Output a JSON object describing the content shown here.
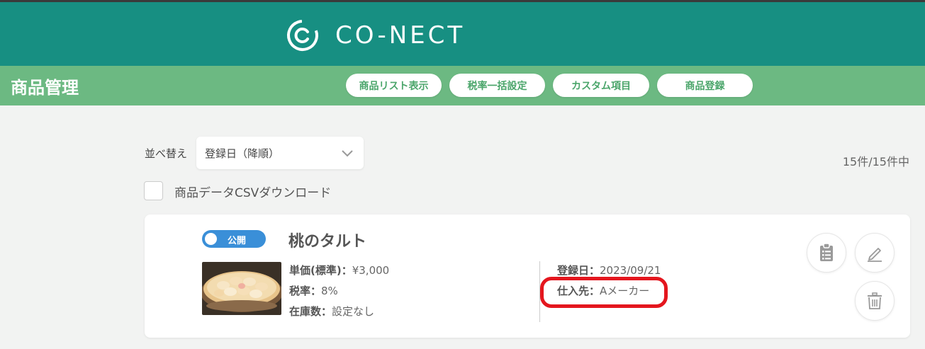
{
  "header": {
    "logo_text": "CO-NECT"
  },
  "subbar": {
    "title": "商品管理",
    "tabs": [
      {
        "label": "商品リスト表示"
      },
      {
        "label": "税率一括設定"
      },
      {
        "label": "カスタム項目"
      },
      {
        "label": "商品登録"
      }
    ]
  },
  "toolbar": {
    "sort_label": "並べ替え",
    "sort_value": "登録日（降順）",
    "count": "15件/15件中",
    "csv_label": "商品データCSVダウンロード"
  },
  "product": {
    "status": "公開",
    "name": "桃のタルト",
    "price_label": "単価(標準)：",
    "price_value": "¥3,000",
    "tax_label": "税率：",
    "tax_value": "8%",
    "stock_label": "在庫数：",
    "stock_value": "設定なし",
    "date_label": "登録日：",
    "date_value": "2023/09/21",
    "supplier_label": "仕入先：",
    "supplier_value": "Aメーカー"
  },
  "colors": {
    "header_bg": "#178f82",
    "subbar_bg": "#6cb982",
    "toggle_on": "#3a8fd8",
    "highlight": "#e4161e"
  },
  "icons": [
    "conect-logo-icon",
    "chevron-down-icon",
    "clipboard-icon",
    "edit-pencil-icon",
    "trash-icon"
  ]
}
